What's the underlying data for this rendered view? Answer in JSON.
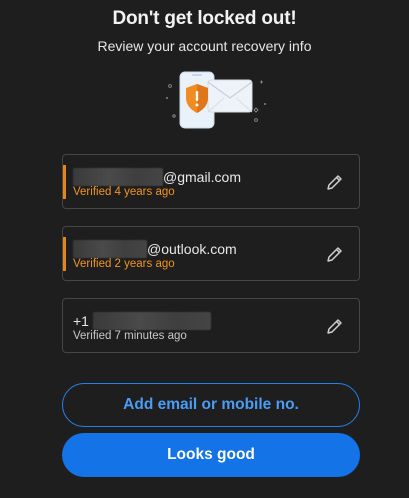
{
  "header": {
    "title": "Don't get locked out!",
    "subtitle": "Review your account recovery info"
  },
  "illustration": {
    "icon": "phone-shield-envelope-icon"
  },
  "recovery_items": [
    {
      "prefix": "",
      "suffix": "@gmail.com",
      "status": "Verified 4 years ago",
      "status_color": "#f29423",
      "warning": true
    },
    {
      "prefix": "",
      "suffix": "@outlook.com",
      "status": "Verified 2 years ago",
      "status_color": "#f29423",
      "warning": true
    },
    {
      "prefix": "+1",
      "suffix": "",
      "status": "Verified 7 minutes ago",
      "status_color": "#c8c8c8",
      "warning": false
    }
  ],
  "actions": {
    "add_label": "Add email or mobile no.",
    "confirm_label": "Looks good"
  },
  "colors": {
    "background": "#1e1e1e",
    "accent_blue": "#1473e6",
    "warning_orange": "#e68619"
  }
}
